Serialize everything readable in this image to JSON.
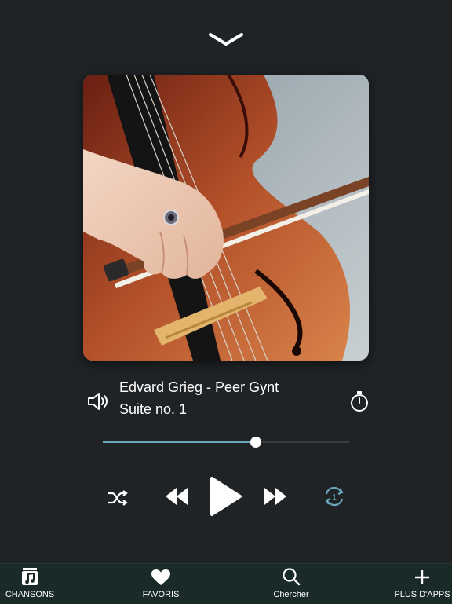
{
  "player": {
    "track_title": "Edvard Grieg - Peer Gynt",
    "track_subtitle": "Suite no. 1",
    "progress": 0.62,
    "repeat_badge": "1"
  },
  "tabbar": {
    "tabs": [
      {
        "label": "CHANSONS",
        "icon": "music-note-icon"
      },
      {
        "label": "FAVORIS",
        "icon": "heart-icon"
      },
      {
        "label": "Chercher",
        "icon": "search-icon"
      },
      {
        "label": "PLUS D'APPS",
        "icon": "plus-icon"
      }
    ]
  },
  "colors": {
    "background": "#1f2326",
    "accent": "#6aa8bc",
    "tabbar": "#1a2a28"
  }
}
